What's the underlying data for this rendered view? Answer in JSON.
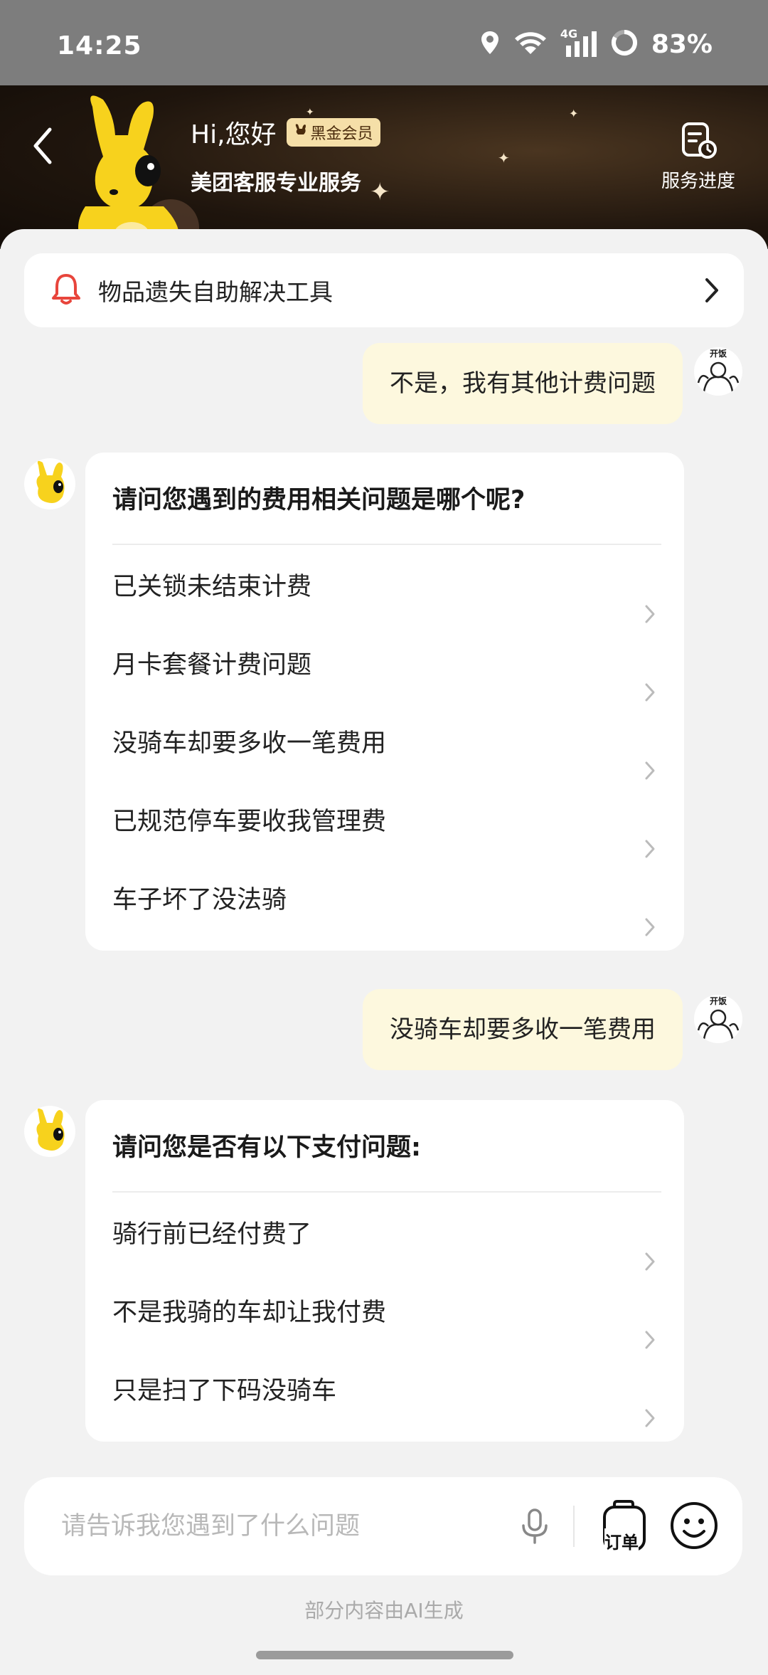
{
  "status": {
    "time": "14:25",
    "network": "4G",
    "battery": "83%"
  },
  "header": {
    "greeting": "Hi,您好",
    "vip_badge": "黑金会员",
    "subtitle": "美团客服专业服务",
    "progress_label": "服务进度"
  },
  "tool_bar": {
    "label": "物品遗失自助解决工具"
  },
  "messages": {
    "user_1": "不是，我有其他计费问题",
    "bot_1": {
      "title": "请问您遇到的费用相关问题是哪个呢?",
      "options": [
        "已关锁未结束计费",
        "月卡套餐计费问题",
        "没骑车却要多收一笔费用",
        "已规范停车要收我管理费",
        "车子坏了没法骑"
      ]
    },
    "user_2": "没骑车却要多收一笔费用",
    "bot_2": {
      "title": "请问您是否有以下支付问题:",
      "options": [
        "骑行前已经付费了",
        "不是我骑的车却让我付费",
        "只是扫了下码没骑车"
      ]
    },
    "user_avatar_text": "开饭"
  },
  "input": {
    "placeholder": "请告诉我您遇到了什么问题",
    "order_label": "订单"
  },
  "footer_note": "部分内容由AI生成",
  "colors": {
    "user_bubble": "#fdf8de",
    "mascot_yellow": "#f7d21d",
    "bell_red": "#e8453c"
  }
}
